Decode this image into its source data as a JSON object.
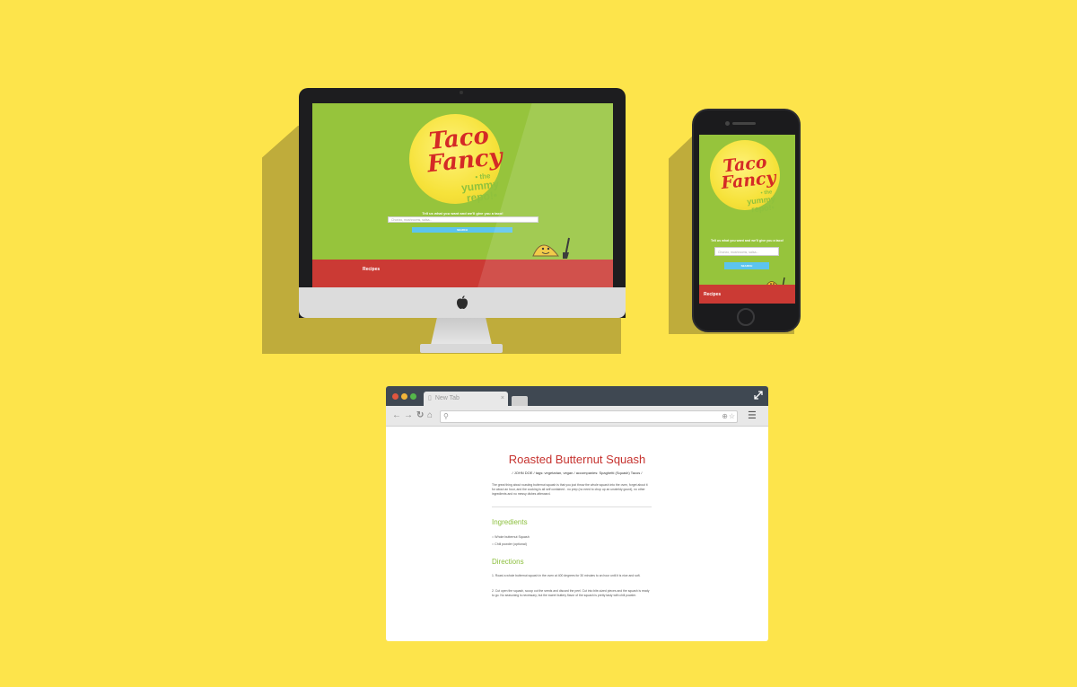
{
  "app": {
    "logo_word1": "Taco",
    "logo_word2": "Fancy",
    "logo_the": "• the",
    "logo_yummy": "yummy",
    "logo_repo": "repo!•",
    "tagline": "Tell us what you want and we'll give you a taco!",
    "search_placeholder": "Chorizo, mushrooms, salsa...",
    "search_button": "SEARCH",
    "footer_link": "Recipes"
  },
  "browser": {
    "tab_title": "New Tab"
  },
  "recipe": {
    "title": "Roasted Butternut Squash",
    "meta": "/ JOHN DOE / tags: vegetarian, vegan / accompanies: Spaghetti (Squash) Tacos /",
    "description": "The great thing about roasting butternut squash is that you just throw the whole squash into the oven, forget about it for about an hour, and the cooking is all self contained - no prep (no need to chop up an unwieldy gourd), no other ingredients and no messy dishes afterward.",
    "ingredients_heading": "Ingredients",
    "ingredients": [
      "Whole butternut Squash",
      "Chili powder (optional)"
    ],
    "directions_heading": "Directions",
    "directions": [
      "1. Roast a whole butternut squash in the oven at 400 degrees for 30 minutes to an hour until it is nice and soft.",
      "2. Cut open the squash, scoop out the seeds and discard the peel. Cut into bite-sized pieces and the squash is ready to go. No seasoning is necessary, but the sweet buttery flavor of the squash is pretty tasty with chili powder."
    ]
  },
  "colors": {
    "background": "#fde44b",
    "screen_green": "#96c43c",
    "logo_red": "#d42a26",
    "footer_red": "#cb3a34",
    "button_blue": "#5cc4ee",
    "heading_green": "#8cbf3d"
  },
  "icons": [
    "apple-logo-icon",
    "taco-mascot-icon",
    "back-arrow-icon",
    "forward-arrow-icon",
    "reload-icon",
    "home-icon",
    "search-icon",
    "zoom-icon",
    "star-icon",
    "menu-icon",
    "fullscreen-icon",
    "page-icon",
    "close-icon"
  ]
}
